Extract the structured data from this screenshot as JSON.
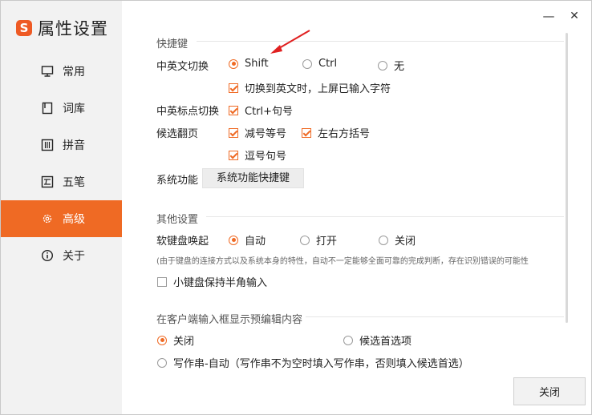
{
  "window": {
    "title": "属性设置",
    "logo_letter": "S",
    "accent_color": "#ef6a24",
    "minimize_glyph": "—",
    "close_glyph": "✕"
  },
  "sidebar": {
    "items": [
      {
        "label": "常用",
        "icon": "monitor-icon",
        "active": false
      },
      {
        "label": "词库",
        "icon": "book-icon",
        "active": false
      },
      {
        "label": "拼音",
        "icon": "grid-icon",
        "active": false
      },
      {
        "label": "五笔",
        "icon": "wubi-icon",
        "active": false
      },
      {
        "label": "高级",
        "icon": "gear-icon",
        "active": true
      },
      {
        "label": "关于",
        "icon": "info-icon",
        "active": false
      }
    ]
  },
  "shortcuts": {
    "section_title": "快捷键",
    "cn_en_switch": {
      "label": "中英文切换",
      "options": [
        "Shift",
        "Ctrl",
        "无"
      ],
      "selected": "Shift",
      "commit_on_switch": {
        "label": "切换到英文时，上屏已输入字符",
        "checked": true
      }
    },
    "punct_switch": {
      "label": "中英标点切换",
      "option": {
        "label": "Ctrl+句号",
        "checked": true
      }
    },
    "paging": {
      "label": "候选翻页",
      "options": [
        {
          "label": "减号等号",
          "checked": true
        },
        {
          "label": "左右方括号",
          "checked": true
        },
        {
          "label": "逗号句号",
          "checked": true
        }
      ]
    },
    "system": {
      "label": "系统功能",
      "button": "系统功能快捷键"
    }
  },
  "other": {
    "section_title": "其他设置",
    "soft_keyboard": {
      "label": "软键盘唤起",
      "options": [
        "自动",
        "打开",
        "关闭"
      ],
      "selected": "自动",
      "note": "(由于键盘的连接方式以及系统本身的特性，自动不一定能够全面可靠的完成判断，存在识别错误的可能性"
    },
    "numpad_halfwidth": {
      "label": "小键盘保持半角输入",
      "checked": false
    }
  },
  "preedit": {
    "section_title": "在客户端输入框显示预编辑内容",
    "options": [
      "关闭",
      "候选首选项",
      "写作串-自动（写作串不为空时填入写作串，否则填入候选首选）"
    ],
    "selected": "关闭"
  },
  "footer": {
    "close_label": "关闭"
  }
}
